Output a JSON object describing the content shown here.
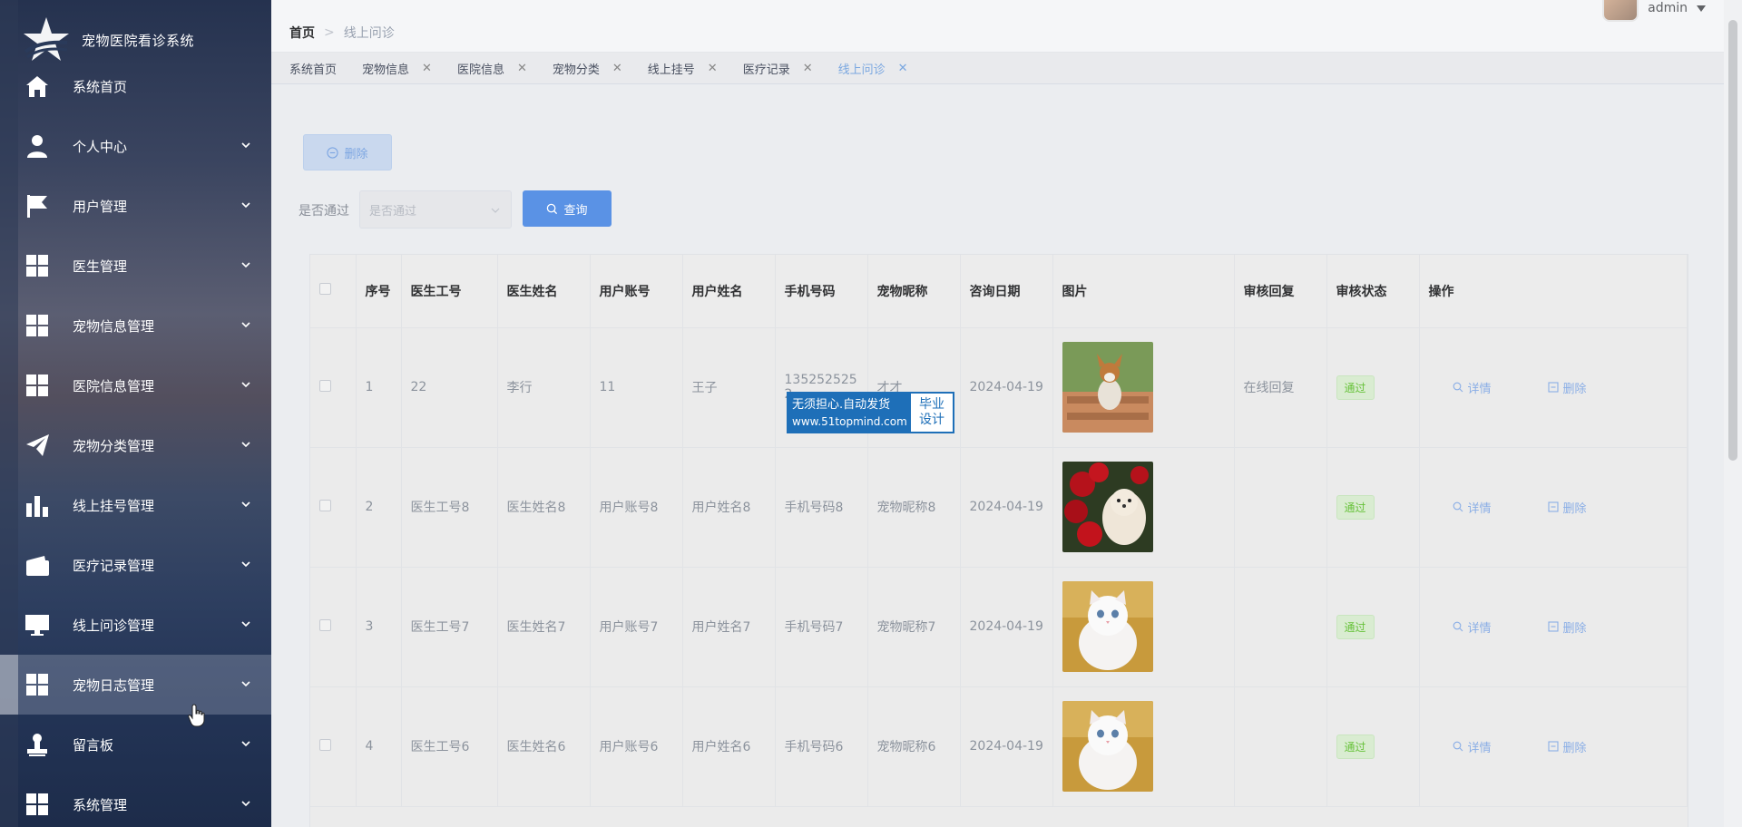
{
  "app": {
    "title": "宠物医院看诊系统"
  },
  "sidebar": {
    "items": [
      {
        "label": "系统首页",
        "icon": "home-icon",
        "caret": false
      },
      {
        "label": "个人中心",
        "icon": "user-icon",
        "caret": true
      },
      {
        "label": "用户管理",
        "icon": "flag-icon",
        "caret": true
      },
      {
        "label": "医生管理",
        "icon": "grid-icon",
        "caret": true
      },
      {
        "label": "宠物信息管理",
        "icon": "grid-icon",
        "caret": true
      },
      {
        "label": "医院信息管理",
        "icon": "grid-icon",
        "caret": true
      },
      {
        "label": "宠物分类管理",
        "icon": "paper-plane-icon",
        "caret": true
      },
      {
        "label": "线上挂号管理",
        "icon": "bar-chart-icon",
        "caret": true
      },
      {
        "label": "医疗记录管理",
        "icon": "wallet-icon",
        "caret": true
      },
      {
        "label": "线上问诊管理",
        "icon": "monitor-icon",
        "caret": true
      },
      {
        "label": "宠物日志管理",
        "icon": "grid-icon",
        "caret": true
      },
      {
        "label": "留言板",
        "icon": "stamp-icon",
        "caret": true
      },
      {
        "label": "系统管理",
        "icon": "grid-icon",
        "caret": true
      }
    ]
  },
  "header": {
    "breadcrumb_home": "首页",
    "breadcrumb_sep": ">",
    "breadcrumb_current": "线上问诊",
    "username": "admin"
  },
  "tags": [
    {
      "label": "系统首页",
      "closable": false
    },
    {
      "label": "宠物信息",
      "closable": true
    },
    {
      "label": "医院信息",
      "closable": true
    },
    {
      "label": "宠物分类",
      "closable": true
    },
    {
      "label": "线上挂号",
      "closable": true
    },
    {
      "label": "医疗记录",
      "closable": true
    },
    {
      "label": "线上问诊",
      "closable": true,
      "active": true
    }
  ],
  "toolbar": {
    "delete_label": "删除",
    "filter_label": "是否通过",
    "filter_placeholder": "是否通过",
    "search_label": "查询"
  },
  "table": {
    "columns": [
      "",
      "序号",
      "医生工号",
      "医生姓名",
      "用户账号",
      "用户姓名",
      "手机号码",
      "宠物昵称",
      "咨询日期",
      "图片",
      "审核回复",
      "审核状态",
      "操作"
    ],
    "rows": [
      {
        "no": "1",
        "doctor_id": "22",
        "doctor_name": "李行",
        "account": "11",
        "user_name": "王子",
        "phone": "135252525",
        "phone2": "2",
        "pet_name": "才才",
        "date": "2024-04-19",
        "image": "corgi",
        "reply": "在线回复",
        "status": "通过"
      },
      {
        "no": "2",
        "doctor_id": "医生工号8",
        "doctor_name": "医生姓名8",
        "account": "用户账号8",
        "user_name": "用户姓名8",
        "phone": "手机号码8",
        "phone2": "",
        "pet_name": "宠物昵称8",
        "date": "2024-04-19",
        "image": "pomeranian",
        "reply": "",
        "status": "通过"
      },
      {
        "no": "3",
        "doctor_id": "医生工号7",
        "doctor_name": "医生姓名7",
        "account": "用户账号7",
        "user_name": "用户姓名7",
        "phone": "手机号码7",
        "phone2": "",
        "pet_name": "宠物昵称7",
        "date": "2024-04-19",
        "image": "white-cat",
        "reply": "",
        "status": "通过"
      },
      {
        "no": "4",
        "doctor_id": "医生工号6",
        "doctor_name": "医生姓名6",
        "account": "用户账号6",
        "user_name": "用户姓名6",
        "phone": "手机号码6",
        "phone2": "",
        "pet_name": "宠物昵称6",
        "date": "2024-04-19",
        "image": "white-cat",
        "reply": "",
        "status": "通过"
      }
    ],
    "detail_label": "详情",
    "delete_label": "删除"
  },
  "watermark": {
    "line1": "无须担心.自动发货",
    "line2": "www.51topmind.com",
    "right1": "毕业",
    "right2": "设计"
  },
  "colors": {
    "primary": "#5a92e5",
    "success": "#67c23a",
    "sidebar": "#2a3a5a"
  }
}
